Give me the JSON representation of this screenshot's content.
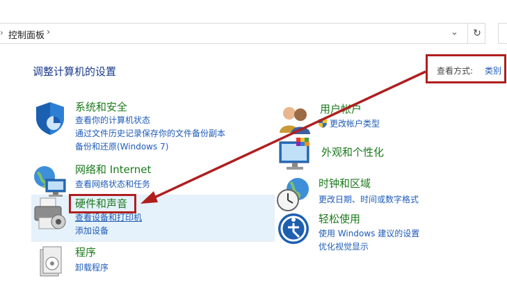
{
  "address_bar": {
    "breadcrumb": "控制面板",
    "separator": "›",
    "dropdown_glyph": "⌄",
    "refresh_glyph": "↻"
  },
  "page_title": "调整计算机的设置",
  "view_by": {
    "label": "查看方式:",
    "value": "类别"
  },
  "left_categories": [
    {
      "title": "系统和安全",
      "links": [
        "查看你的计算机状态",
        "通过文件历史记录保存你的文件备份副本",
        "备份和还原(Windows 7)"
      ],
      "icon": "shield-icon"
    },
    {
      "title": "网络和 Internet",
      "links": [
        "查看网络状态和任务"
      ],
      "icon": "network-icon"
    },
    {
      "title": "硬件和声音",
      "links": [
        "查看设备和打印机",
        "添加设备"
      ],
      "icon": "printer-icon"
    },
    {
      "title": "程序",
      "links": [
        "卸载程序"
      ],
      "icon": "programs-icon"
    }
  ],
  "right_categories": [
    {
      "title": "用户帐户",
      "links": [
        "更改帐户类型"
      ],
      "icon": "users-icon"
    },
    {
      "title": "外观和个性化",
      "links": [],
      "icon": "monitor-palette-icon"
    },
    {
      "title": "时钟和区域",
      "links": [
        "更改日期、时间或数字格式"
      ],
      "icon": "clock-globe-icon"
    },
    {
      "title": "轻松使用",
      "links": [
        "使用 Windows 建议的设置",
        "优化视觉显示"
      ],
      "icon": "accessibility-icon"
    }
  ],
  "colors": {
    "annotation": "#b01e1e",
    "link": "#1e5bb8",
    "category_title": "#1b7a1b",
    "highlight": "#e5f1fb"
  }
}
